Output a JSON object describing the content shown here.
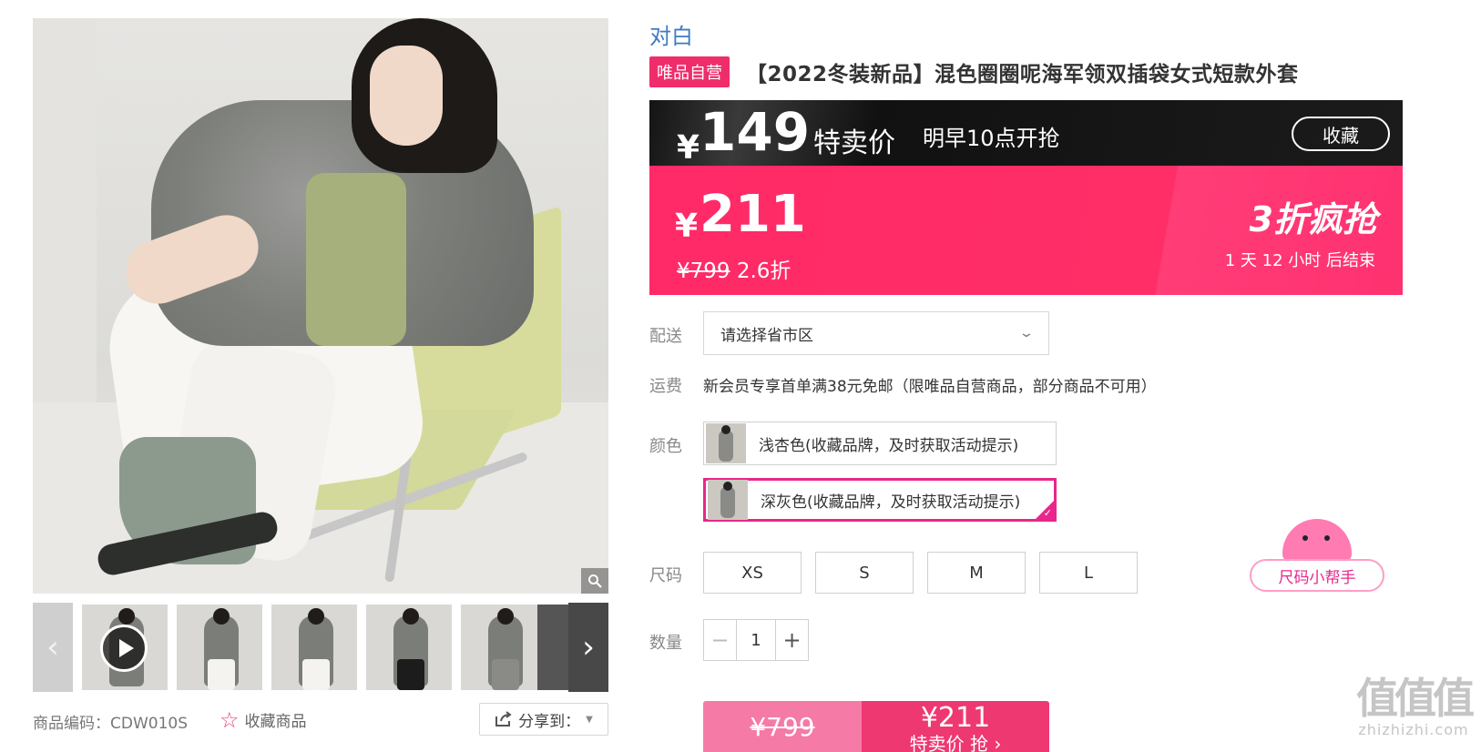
{
  "gallery": {
    "zoom_icon": "magnifier-icon",
    "prev_glyph": "‹",
    "next_glyph": "›",
    "thumbnail_count": 6
  },
  "meta": {
    "sku_label": "商品编码：CDW010S",
    "favorite_label": "收藏商品",
    "share_label": "分享到："
  },
  "product": {
    "brand": "对白",
    "self_operated_tag": "唯品自营",
    "title": "【2022冬装新品】混色圈圈呢海军领双插袋女式短款外套"
  },
  "special": {
    "currency": "¥",
    "price": "149",
    "label": "特卖价",
    "start_time": "明早10点开抢",
    "favorite_button": "收藏"
  },
  "flash": {
    "currency": "¥",
    "price": "211",
    "original_price": "¥799",
    "discount": "2.6折",
    "promo": "3折疯抢",
    "countdown": "1 天 12 小时 后结束"
  },
  "delivery": {
    "label": "配送",
    "placeholder": "请选择省市区"
  },
  "shipping": {
    "label": "运费",
    "text": "新会员专享首单满38元免邮（限唯品自营商品，部分商品不可用）"
  },
  "color": {
    "label": "颜色",
    "options": [
      {
        "name": "浅杏色(收藏品牌，及时获取活动提示)",
        "selected": false
      },
      {
        "name": "深灰色(收藏品牌，及时获取活动提示)",
        "selected": true
      }
    ]
  },
  "size": {
    "label": "尺码",
    "options": [
      "XS",
      "S",
      "M",
      "L"
    ],
    "helper_label": "尺码小帮手"
  },
  "quantity": {
    "label": "数量",
    "value": "1",
    "minus": "−",
    "plus": "+"
  },
  "buy": {
    "original_price": "¥799",
    "price": "¥211",
    "action_label": "特卖价 抢 ›"
  },
  "watermark": {
    "big": "值值值",
    "small": "zhizhizhi.com"
  },
  "colors": {
    "accent_pink": "#ef2d6b",
    "brand_blue": "#3f7bc4",
    "selected_border": "#e8278c"
  }
}
